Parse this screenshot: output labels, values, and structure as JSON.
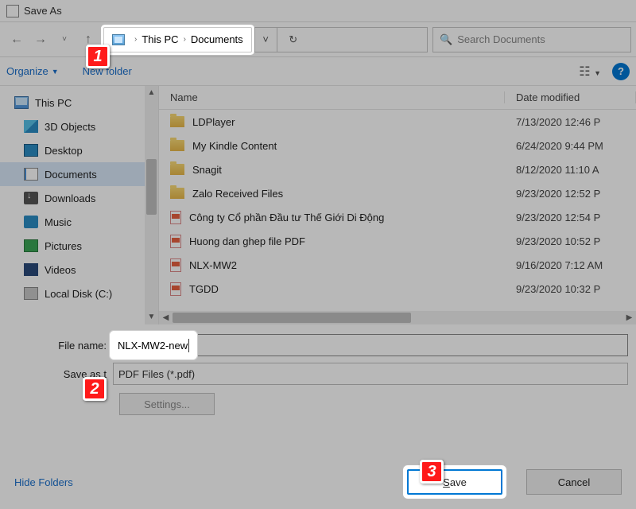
{
  "title": "Save As",
  "breadcrumb": {
    "seg1": "This PC",
    "seg2": "Documents"
  },
  "search": {
    "placeholder": "Search Documents"
  },
  "toolbar": {
    "organize": "Organize",
    "newfolder": "New folder"
  },
  "sidebar": {
    "items": [
      {
        "label": "This PC"
      },
      {
        "label": "3D Objects"
      },
      {
        "label": "Desktop"
      },
      {
        "label": "Documents"
      },
      {
        "label": "Downloads"
      },
      {
        "label": "Music"
      },
      {
        "label": "Pictures"
      },
      {
        "label": "Videos"
      },
      {
        "label": "Local Disk (C:)"
      }
    ]
  },
  "columns": {
    "name": "Name",
    "date": "Date modified"
  },
  "files": [
    {
      "name": "LDPlayer",
      "date": "7/13/2020 12:46 P",
      "type": "folder"
    },
    {
      "name": "My Kindle Content",
      "date": "6/24/2020 9:44 PM",
      "type": "folder"
    },
    {
      "name": "Snagit",
      "date": "8/12/2020 11:10 A",
      "type": "folder"
    },
    {
      "name": "Zalo Received Files",
      "date": "9/23/2020 12:52 P",
      "type": "folder"
    },
    {
      "name": "Công ty Cổ phần Đầu tư Thế Giới Di Động",
      "date": "9/23/2020 12:54 P",
      "type": "pdf"
    },
    {
      "name": "Huong dan ghep file PDF",
      "date": "9/23/2020 10:52 P",
      "type": "pdf"
    },
    {
      "name": "NLX-MW2",
      "date": "9/16/2020 7:12 AM",
      "type": "pdf"
    },
    {
      "name": "TGDD",
      "date": "9/23/2020 10:32 P",
      "type": "pdf"
    }
  ],
  "form": {
    "filename_label": "File name:",
    "filename_value": "NLX-MW2-new",
    "type_label": "Save as type:",
    "type_label_cut": "Save as t",
    "type_value": "PDF Files (*.pdf)",
    "settings": "Settings..."
  },
  "footer": {
    "hide": "Hide Folders",
    "save": "ave",
    "save_u": "S",
    "cancel": "Cancel"
  },
  "annotations": {
    "a1": "1",
    "a2": "2",
    "a3": "3"
  }
}
